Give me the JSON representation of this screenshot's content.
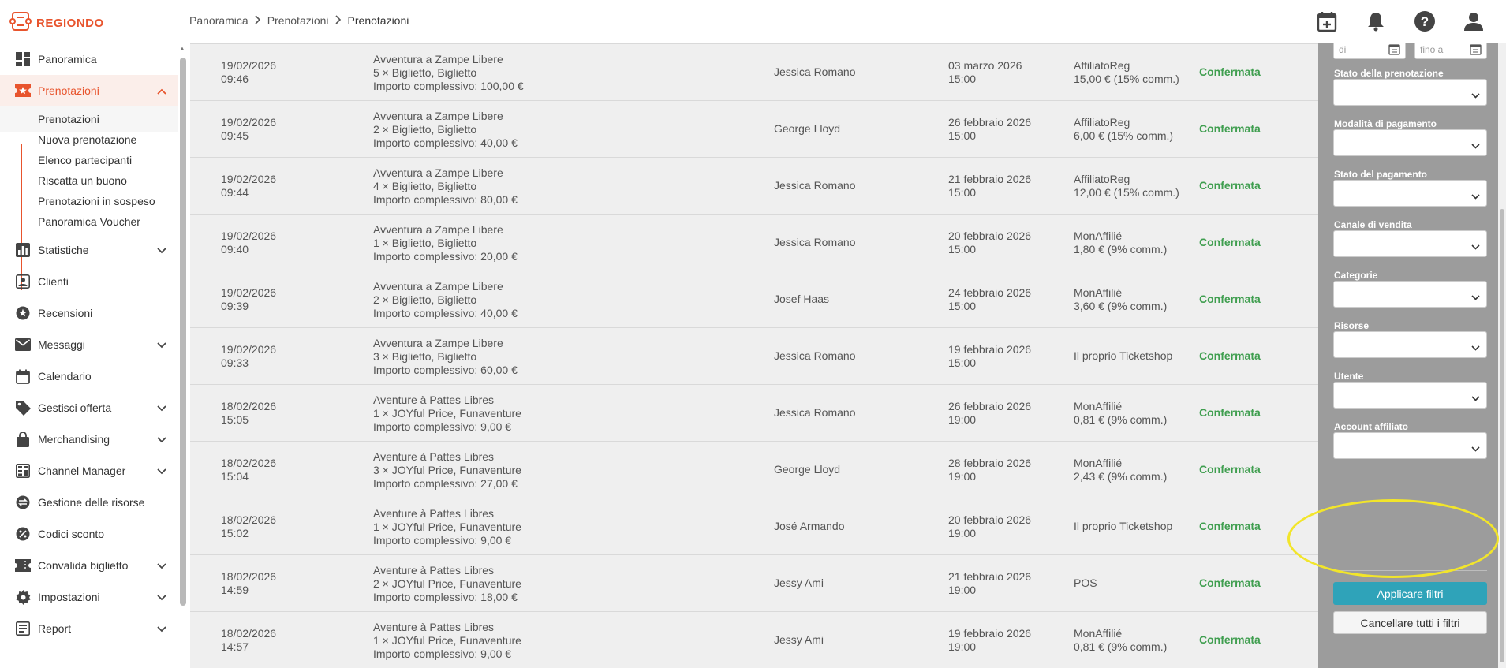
{
  "app": {
    "logo_text": "REGIONDO",
    "brand_color": "#e8542d",
    "accent_color": "#2fa3b9",
    "status_color": "#3f9e4f"
  },
  "breadcrumb": [
    "Panoramica",
    "Prenotazioni",
    "Prenotazioni"
  ],
  "top_icons": [
    "calendar-add-icon",
    "bell-icon",
    "help-icon",
    "user-icon"
  ],
  "sidebar": {
    "items": [
      {
        "label": "Panoramica",
        "icon": "dashboard-icon"
      },
      {
        "label": "Prenotazioni",
        "icon": "ticket-star-icon"
      },
      {
        "label": "Statistiche",
        "icon": "bar-chart-icon"
      },
      {
        "label": "Clienti",
        "icon": "person-icon"
      },
      {
        "label": "Recensioni",
        "icon": "star-circle-icon"
      },
      {
        "label": "Messaggi",
        "icon": "mail-icon"
      },
      {
        "label": "Calendario",
        "icon": "calendar-icon"
      },
      {
        "label": "Gestisci offerta",
        "icon": "tag-icon"
      },
      {
        "label": "Merchandising",
        "icon": "bag-icon"
      },
      {
        "label": "Channel Manager",
        "icon": "channels-icon"
      },
      {
        "label": "Gestione delle risorse",
        "icon": "swap-icon"
      },
      {
        "label": "Codici sconto",
        "icon": "percent-icon"
      },
      {
        "label": "Convalida biglietto",
        "icon": "ticket-icon"
      },
      {
        "label": "Impostazioni",
        "icon": "gear-icon"
      },
      {
        "label": "Report",
        "icon": "report-icon"
      }
    ],
    "sub_items": [
      "Prenotazioni",
      "Nuova prenotazione",
      "Elenco partecipanti",
      "Riscatta un buono",
      "Prenotazioni in sospeso",
      "Panoramica Voucher"
    ]
  },
  "bookings": [
    {
      "date": "19/02/2026",
      "time": "09:46",
      "product": "Avventura a Zampe Libere",
      "tickets": "5 × Biglietto, Biglietto",
      "total": "Importo complessivo: 100,00 €",
      "customer": "Jessica Romano",
      "event_date": "03 marzo 2026",
      "event_time": "15:00",
      "channel": "AffiliatoReg",
      "commission": "15,00 € (15% comm.)",
      "status": "Confermata"
    },
    {
      "date": "19/02/2026",
      "time": "09:45",
      "product": "Avventura a Zampe Libere",
      "tickets": "2 × Biglietto, Biglietto",
      "total": "Importo complessivo: 40,00 €",
      "customer": "George Lloyd",
      "event_date": "26 febbraio 2026",
      "event_time": "15:00",
      "channel": "AffiliatoReg",
      "commission": "6,00 € (15% comm.)",
      "status": "Confermata"
    },
    {
      "date": "19/02/2026",
      "time": "09:44",
      "product": "Avventura a Zampe Libere",
      "tickets": "4 × Biglietto, Biglietto",
      "total": "Importo complessivo: 80,00 €",
      "customer": "Jessica Romano",
      "event_date": "21 febbraio 2026",
      "event_time": "15:00",
      "channel": "AffiliatoReg",
      "commission": "12,00 € (15% comm.)",
      "status": "Confermata"
    },
    {
      "date": "19/02/2026",
      "time": "09:40",
      "product": "Avventura a Zampe Libere",
      "tickets": "1 × Biglietto, Biglietto",
      "total": "Importo complessivo: 20,00 €",
      "customer": "Jessica Romano",
      "event_date": "20 febbraio 2026",
      "event_time": "15:00",
      "channel": "MonAffilié",
      "commission": "1,80 € (9% comm.)",
      "status": "Confermata"
    },
    {
      "date": "19/02/2026",
      "time": "09:39",
      "product": "Avventura a Zampe Libere",
      "tickets": "2 × Biglietto, Biglietto",
      "total": "Importo complessivo: 40,00 €",
      "customer": "Josef Haas",
      "event_date": "24 febbraio 2026",
      "event_time": "15:00",
      "channel": "MonAffilié",
      "commission": "3,60 € (9% comm.)",
      "status": "Confermata"
    },
    {
      "date": "19/02/2026",
      "time": "09:33",
      "product": "Avventura a Zampe Libere",
      "tickets": "3 × Biglietto, Biglietto",
      "total": "Importo complessivo: 60,00 €",
      "customer": "Jessica Romano",
      "event_date": "19 febbraio 2026",
      "event_time": "15:00",
      "channel": "Il proprio Ticketshop",
      "commission": "",
      "status": "Confermata"
    },
    {
      "date": "18/02/2026",
      "time": "15:05",
      "product": "Aventure à Pattes Libres",
      "tickets": "1 × JOYful Price, Funaventure",
      "total": "Importo complessivo: 9,00 €",
      "customer": "Jessica Romano",
      "event_date": "26 febbraio 2026",
      "event_time": "19:00",
      "channel": "MonAffilié",
      "commission": "0,81 € (9% comm.)",
      "status": "Confermata"
    },
    {
      "date": "18/02/2026",
      "time": "15:04",
      "product": "Aventure à Pattes Libres",
      "tickets": "3 × JOYful Price, Funaventure",
      "total": "Importo complessivo: 27,00 €",
      "customer": "George Lloyd",
      "event_date": "28 febbraio 2026",
      "event_time": "19:00",
      "channel": "MonAffilié",
      "commission": "2,43 € (9% comm.)",
      "status": "Confermata"
    },
    {
      "date": "18/02/2026",
      "time": "15:02",
      "product": "Aventure à Pattes Libres",
      "tickets": "1 × JOYful Price, Funaventure",
      "total": "Importo complessivo: 9,00 €",
      "customer": "José Armando",
      "event_date": "20 febbraio 2026",
      "event_time": "19:00",
      "channel": "Il proprio Ticketshop",
      "commission": "",
      "status": "Confermata"
    },
    {
      "date": "18/02/2026",
      "time": "14:59",
      "product": "Aventure à Pattes Libres",
      "tickets": "2 × JOYful Price, Funaventure",
      "total": "Importo complessivo: 18,00 €",
      "customer": "Jessy Ami",
      "event_date": "21 febbraio 2026",
      "event_time": "19:00",
      "channel": "POS",
      "commission": "",
      "status": "Confermata"
    },
    {
      "date": "18/02/2026",
      "time": "14:57",
      "product": "Aventure à Pattes Libres",
      "tickets": "1 × JOYful Price, Funaventure",
      "total": "Importo complessivo: 9,00 €",
      "customer": "Jessy Ami",
      "event_date": "19 febbraio 2026",
      "event_time": "19:00",
      "channel": "MonAffilié",
      "commission": "0,81 € (9% comm.)",
      "status": "Confermata"
    }
  ],
  "filters": {
    "date_from_placeholder": "di",
    "date_to_placeholder": "fino a",
    "fields": [
      "Stato della prenotazione",
      "Modalità di pagamento",
      "Stato del pagamento",
      "Canale di vendita",
      "Categorie",
      "Risorse",
      "Utente",
      "Account affiliato"
    ],
    "apply_label": "Applicare filtri",
    "clear_label": "Cancellare tutti i filtri"
  }
}
